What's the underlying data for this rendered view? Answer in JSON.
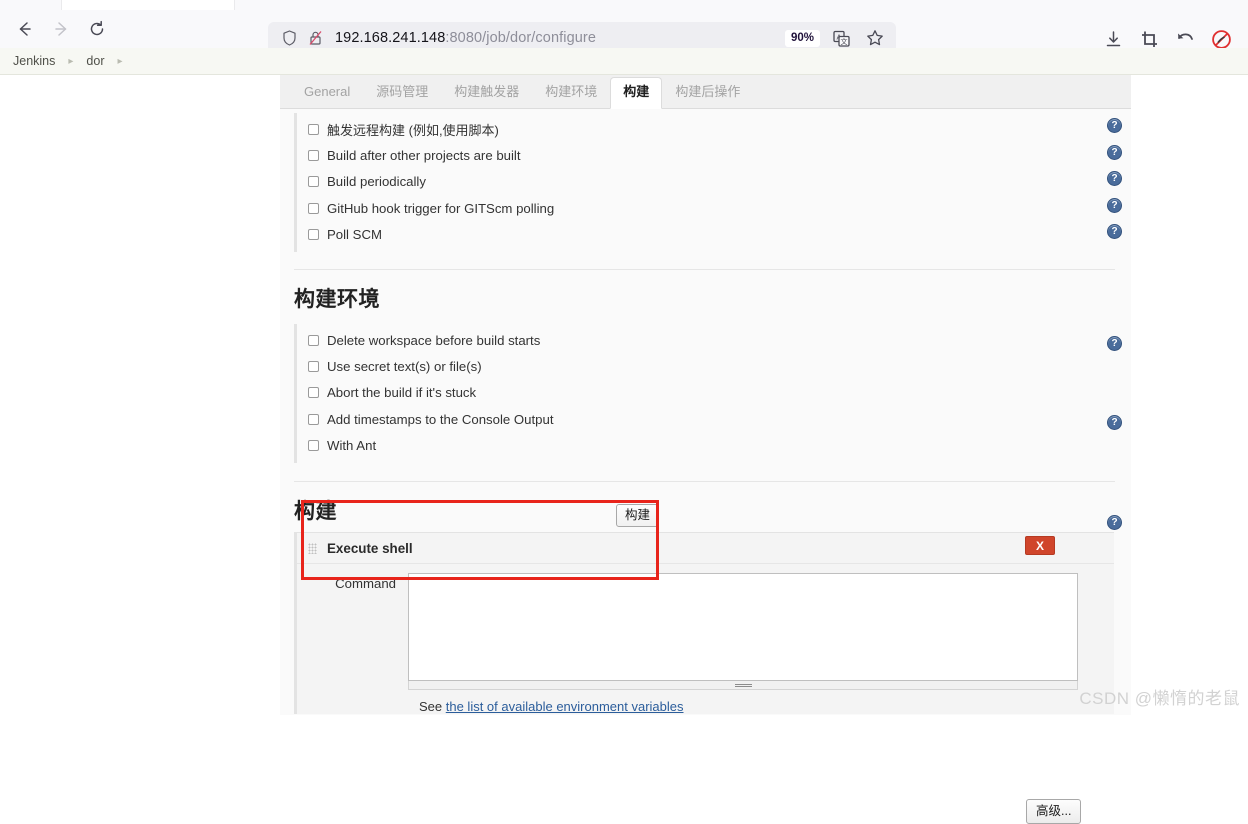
{
  "browser": {
    "nav": {
      "back_icon": "arrow-left-icon",
      "forward_icon": "arrow-right-icon",
      "reload_icon": "reload-icon"
    },
    "address_bar": {
      "shield_icon": "shield-icon",
      "lock_icon": "lock-crossed-icon",
      "url_host": "192.168.241.148",
      "url_path": ":8080/job/dor/configure",
      "zoom_level": "90%",
      "translate_icon": "translate-icon",
      "bookmark_icon": "star-icon"
    },
    "toolbar_right": [
      {
        "icon": "download-icon"
      },
      {
        "icon": "screenshot-crop-icon"
      },
      {
        "icon": "undo-arrow-icon"
      },
      {
        "icon": "blocked-circle-icon"
      }
    ]
  },
  "breadcrumb": {
    "items": [
      {
        "label": "Jenkins"
      },
      {
        "label": "dor"
      }
    ],
    "separator": "▸"
  },
  "tabs": [
    {
      "label": "General",
      "active": false
    },
    {
      "label": "源码管理",
      "active": false
    },
    {
      "label": "构建触发器",
      "active": false
    },
    {
      "label": "构建环境",
      "active": false
    },
    {
      "label": "构建",
      "active": true
    },
    {
      "label": "构建后操作",
      "active": false
    }
  ],
  "triggers": {
    "items": [
      {
        "label": "触发远程构建 (例如,使用脚本)",
        "checked": false,
        "help": true
      },
      {
        "label": "Build after other projects are built",
        "checked": false,
        "help": true
      },
      {
        "label": "Build periodically",
        "checked": false,
        "help": true
      },
      {
        "label": "GitHub hook trigger for GITScm polling",
        "checked": false,
        "help": true
      },
      {
        "label": "Poll SCM",
        "checked": false,
        "help": true
      }
    ]
  },
  "build_env": {
    "title": "构建环境",
    "items": [
      {
        "label": "Delete workspace before build starts",
        "checked": false,
        "help": false
      },
      {
        "label": "Use secret text(s) or file(s)",
        "checked": false,
        "help": true
      },
      {
        "label": "Abort the build if it's stuck",
        "checked": false,
        "help": false
      },
      {
        "label": "Add timestamps to the Console Output",
        "checked": false,
        "help": false
      },
      {
        "label": "With Ant",
        "checked": false,
        "help": true
      }
    ]
  },
  "build": {
    "title": "构建",
    "add_step_button": "构建",
    "builder": {
      "grip_icon": "drag-handle-icon",
      "name": "Execute shell",
      "delete_button": "X",
      "help_icon": "help-icon",
      "command_label": "Command",
      "command_value": "",
      "command_placeholder": "",
      "env_note_prefix": "See ",
      "env_note_link": "the list of available environment variables"
    },
    "advanced_button": "高级..."
  },
  "watermark": "CSDN @懒惰的老鼠",
  "help_icon_glyph": "?",
  "colors": {
    "accent_red": "#e8241b",
    "delete_red": "#d0452b",
    "help_blue": "#4a6c9b",
    "link_blue": "#2b5d9b",
    "breadcrumb_bg": "#f7f8f3"
  }
}
